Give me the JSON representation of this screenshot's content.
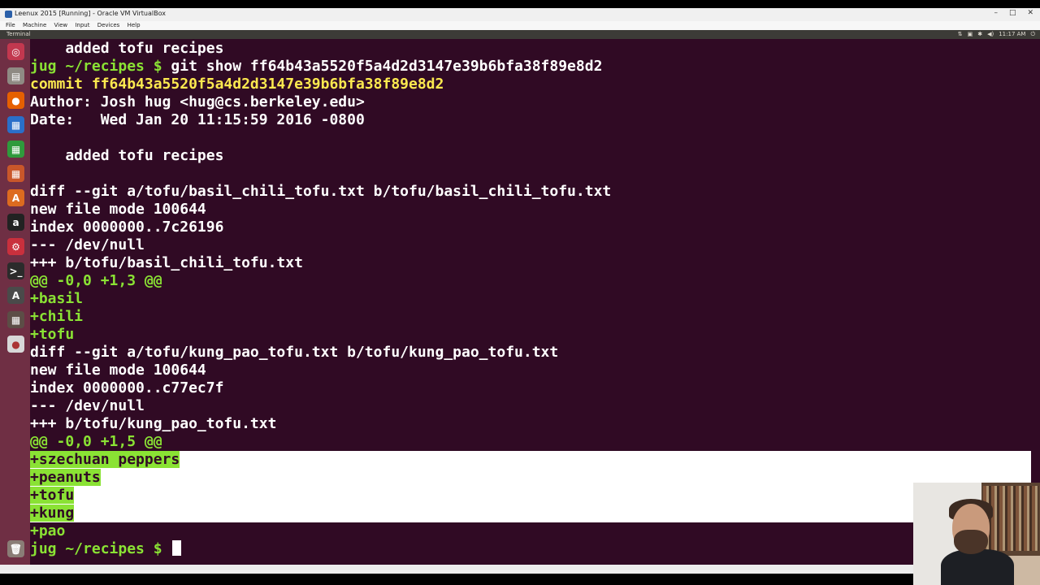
{
  "window": {
    "title": "Leenux 2015 [Running] - Oracle VM VirtualBox",
    "controls": [
      "–",
      "□",
      "✕"
    ]
  },
  "menubar": [
    "File",
    "Machine",
    "View",
    "Input",
    "Devices",
    "Help"
  ],
  "panel": {
    "app_name": "Terminal",
    "clock": "11:17 AM"
  },
  "launcher": [
    {
      "icon": "ubuntu-dash-icon",
      "glyph": "◎",
      "color": "#c2384f"
    },
    {
      "icon": "files-icon",
      "glyph": "▤",
      "color": "#8f8a83"
    },
    {
      "icon": "firefox-icon",
      "glyph": "●",
      "color": "#e66000"
    },
    {
      "icon": "writer-icon",
      "glyph": "▦",
      "color": "#2a6fc9"
    },
    {
      "icon": "calc-icon",
      "glyph": "▦",
      "color": "#2f9a3c"
    },
    {
      "icon": "impress-icon",
      "glyph": "▦",
      "color": "#c9572a"
    },
    {
      "icon": "software-center-icon",
      "glyph": "A",
      "color": "#dd6b1f"
    },
    {
      "icon": "amazon-icon",
      "glyph": "a",
      "color": "#222222"
    },
    {
      "icon": "settings-icon",
      "glyph": "⚙",
      "color": "#c9303d"
    },
    {
      "icon": "terminal-icon",
      "glyph": ">_",
      "color": "#2b2b2b"
    },
    {
      "icon": "updater-icon",
      "glyph": "A",
      "color": "#4a4a4a"
    },
    {
      "icon": "workspace-icon",
      "glyph": "▦",
      "color": "#5c4d46"
    },
    {
      "icon": "dvd-icon",
      "glyph": "●",
      "color": "#d8d8d8"
    },
    {
      "icon": "trash-icon",
      "glyph": "🗑",
      "color": "#8a7d76"
    }
  ],
  "terminal": {
    "lines": [
      {
        "segments": [
          {
            "text": "    added tofu recipes"
          }
        ]
      },
      {
        "segments": [
          {
            "text": "jug ~/recipes $ ",
            "cls": "green"
          },
          {
            "text": "git show ff64b43a5520f5a4d2d3147e39b6bfa38f89e8d2"
          }
        ]
      },
      {
        "segments": [
          {
            "text": "commit ff64b43a5520f5a4d2d3147e39b6bfa38f89e8d2",
            "cls": "yellow"
          }
        ]
      },
      {
        "segments": [
          {
            "text": "Author: Josh hug <hug@cs.berkeley.edu>"
          }
        ]
      },
      {
        "segments": [
          {
            "text": "Date:   Wed Jan 20 11:15:59 2016 -0800"
          }
        ]
      },
      {
        "segments": [
          {
            "text": ""
          }
        ]
      },
      {
        "segments": [
          {
            "text": "    added tofu recipes"
          }
        ]
      },
      {
        "segments": [
          {
            "text": ""
          }
        ]
      },
      {
        "segments": [
          {
            "text": "diff --git a/tofu/basil_chili_tofu.txt b/tofu/basil_chili_tofu.txt"
          }
        ]
      },
      {
        "segments": [
          {
            "text": "new file mode 100644"
          }
        ]
      },
      {
        "segments": [
          {
            "text": "index 0000000..7c26196"
          }
        ]
      },
      {
        "segments": [
          {
            "text": "--- /dev/null"
          }
        ]
      },
      {
        "segments": [
          {
            "text": "+++ b/tofu/basil_chili_tofu.txt"
          }
        ]
      },
      {
        "segments": [
          {
            "text": "@@ -0,0 +1,3 @@",
            "cls": "green"
          }
        ]
      },
      {
        "segments": [
          {
            "text": "+basil",
            "cls": "green"
          }
        ]
      },
      {
        "segments": [
          {
            "text": "+chili",
            "cls": "green"
          }
        ]
      },
      {
        "segments": [
          {
            "text": "+tofu",
            "cls": "green"
          }
        ]
      },
      {
        "segments": [
          {
            "text": "diff --git a/tofu/kung_pao_tofu.txt b/tofu/kung_pao_tofu.txt"
          }
        ]
      },
      {
        "segments": [
          {
            "text": "new file mode 100644"
          }
        ]
      },
      {
        "segments": [
          {
            "text": "index 0000000..c77ec7f"
          }
        ]
      },
      {
        "segments": [
          {
            "text": "--- /dev/null"
          }
        ]
      },
      {
        "segments": [
          {
            "text": "+++ b/tofu/kung_pao_tofu.txt"
          }
        ]
      },
      {
        "segments": [
          {
            "text": "@@ -0,0 +1,5 @@",
            "cls": "green"
          }
        ]
      },
      {
        "segments": [
          {
            "text": "+szechuan peppers",
            "cls": "sel"
          }
        ],
        "selected": true
      },
      {
        "segments": [
          {
            "text": "+peanuts",
            "cls": "sel"
          }
        ],
        "selected": true
      },
      {
        "segments": [
          {
            "text": "+tofu",
            "cls": "sel"
          }
        ],
        "selected": true
      },
      {
        "segments": [
          {
            "text": "+kung",
            "cls": "sel"
          }
        ],
        "selected": true
      },
      {
        "segments": [
          {
            "text": "+pao",
            "cls": "green"
          }
        ]
      },
      {
        "segments": [
          {
            "text": "jug ~/recipes $ ",
            "cls": "green"
          }
        ],
        "cursor": true
      }
    ]
  },
  "colors": {
    "terminal_bg": "#300a24",
    "prompt_green": "#8ae234",
    "commit_yellow": "#fce94f",
    "launcher_bg": "#6f2f44"
  }
}
